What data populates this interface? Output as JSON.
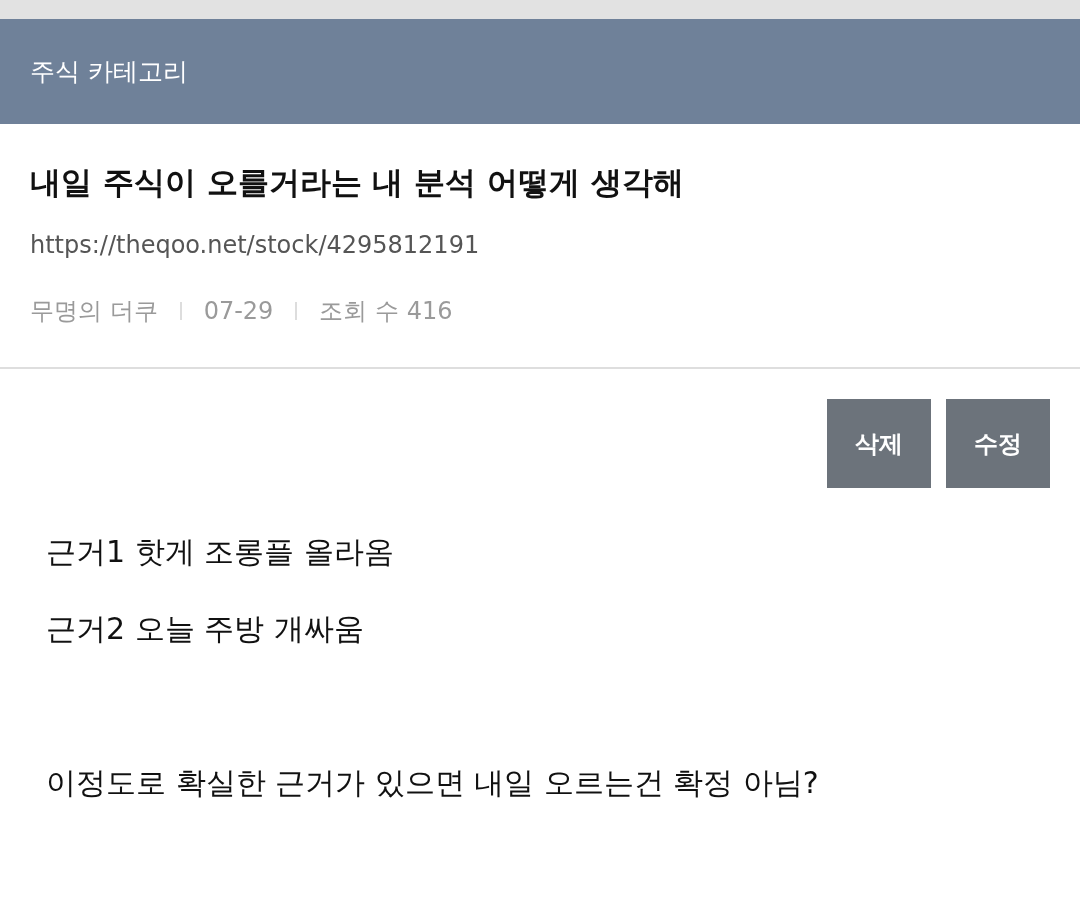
{
  "header": {
    "category": "주식 카테고리"
  },
  "post": {
    "title": "내일 주식이 오를거라는 내 분석 어떻게 생각해",
    "url": "https://theqoo.net/stock/4295812191",
    "meta": [
      "무명의 더쿠",
      "07-29",
      "조회 수 416"
    ]
  },
  "buttons": [
    "삭제",
    "수정"
  ],
  "body": {
    "paragraphs": [
      [
        "근거1 핫게 조롱플 올라옴",
        "근거2 오늘 주방 개싸움"
      ],
      [
        "이정도로 확실한 근거가 있으면 내일 오르는건 확정 아님?"
      ]
    ]
  }
}
